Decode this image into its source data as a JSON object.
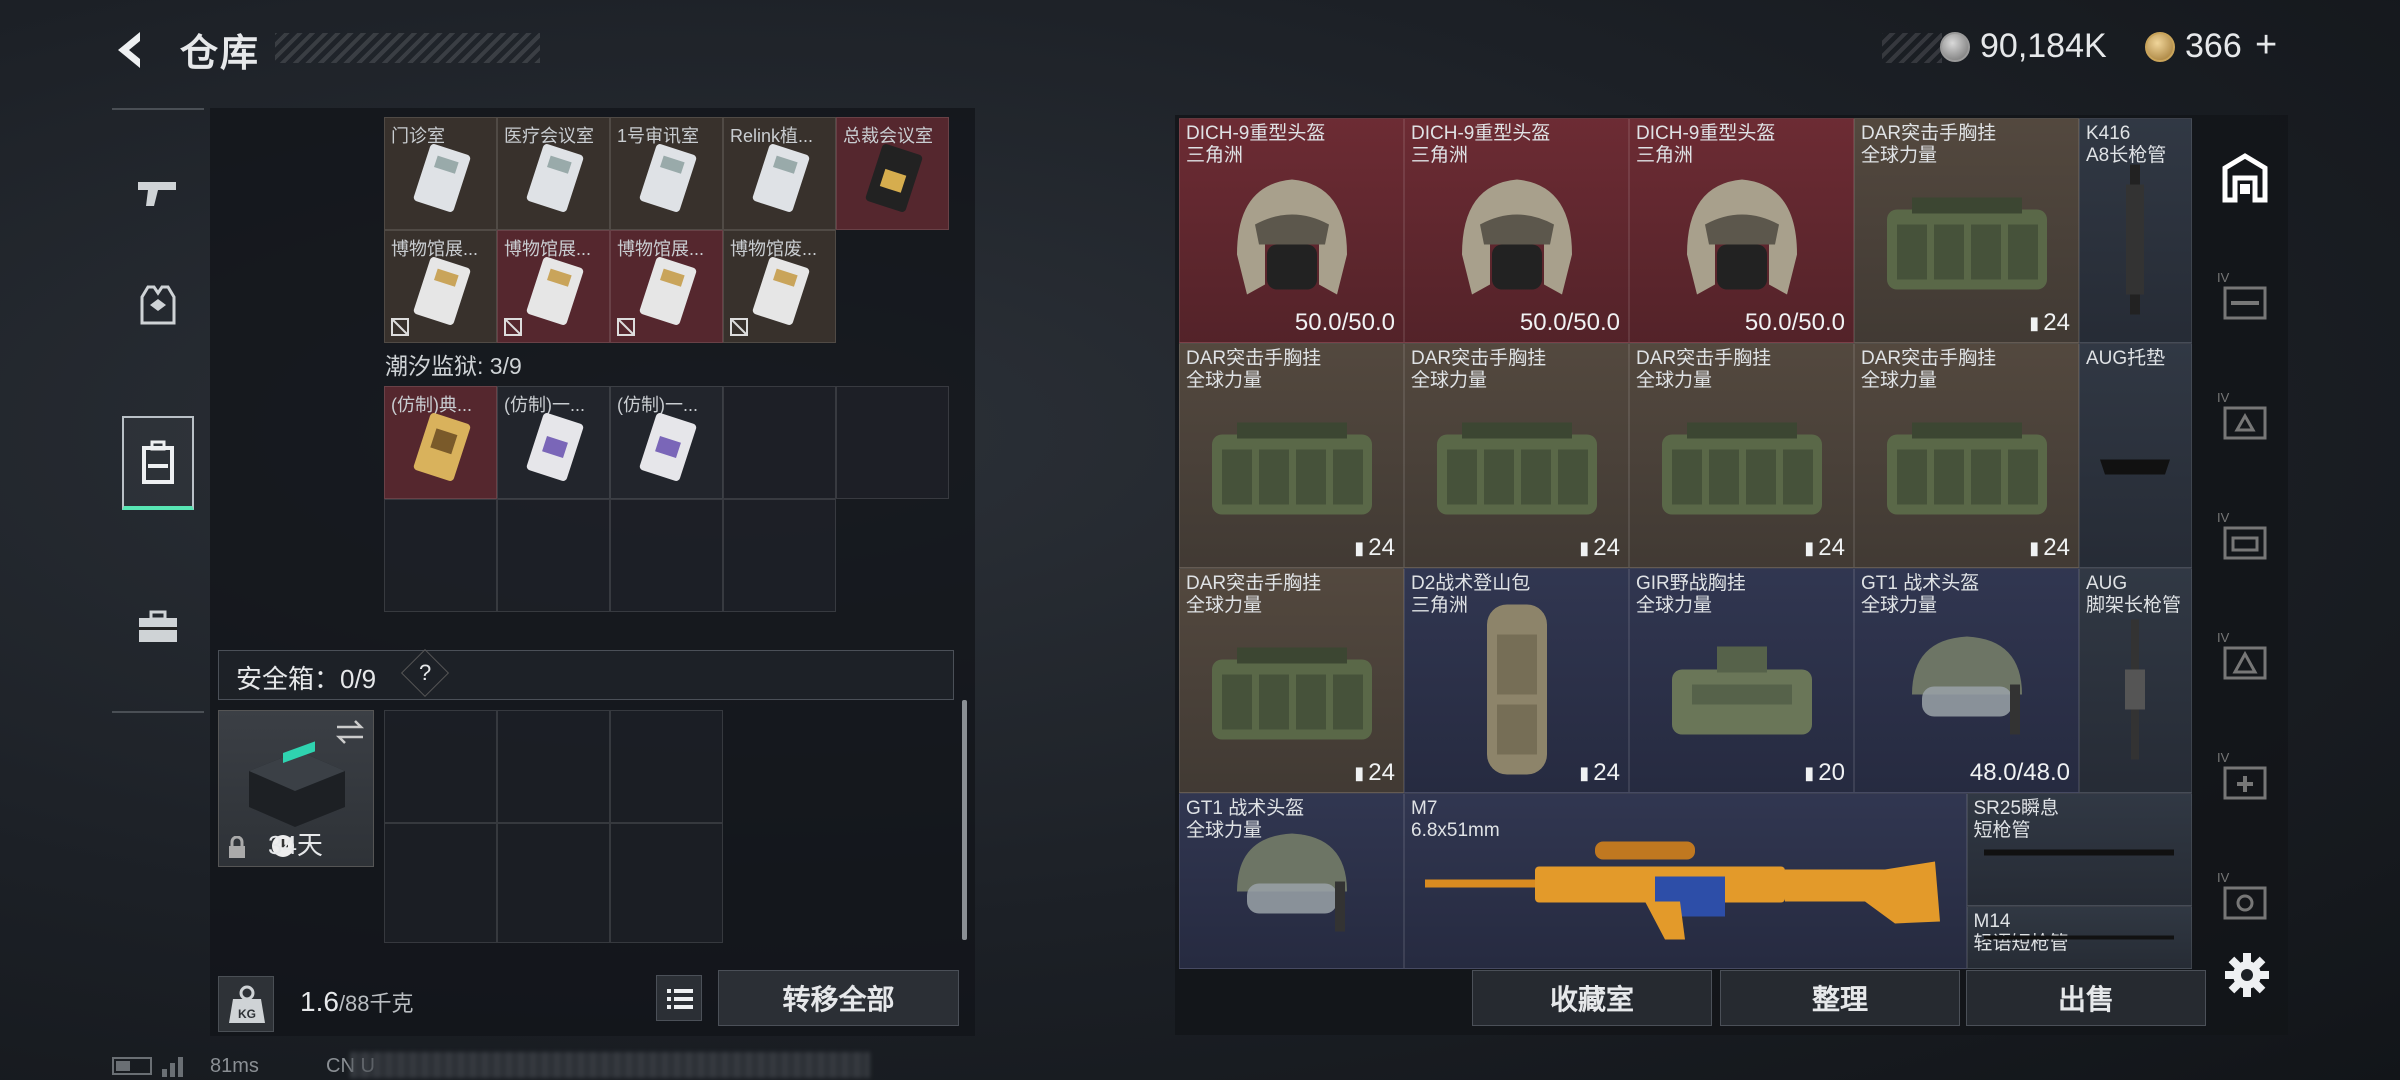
{
  "header": {
    "title": "仓库",
    "money": "90,184K",
    "tickets": "366",
    "plus": "+"
  },
  "nav": [
    {
      "name": "nav-weapons"
    },
    {
      "name": "nav-equipment"
    },
    {
      "name": "nav-storage"
    },
    {
      "name": "nav-toolbox"
    }
  ],
  "keycards": {
    "row1": [
      {
        "label": "门诊室",
        "color": "brown"
      },
      {
        "label": "医疗会议室",
        "color": "brown"
      },
      {
        "label": "1号审讯室",
        "color": "brown"
      },
      {
        "label": "Relink植...",
        "color": "brown"
      },
      {
        "label": "总裁会议室",
        "color": "red"
      }
    ],
    "row2": [
      {
        "label": "博物馆展...",
        "color": "brown"
      },
      {
        "label": "博物馆展...",
        "color": "red"
      },
      {
        "label": "博物馆展...",
        "color": "red"
      },
      {
        "label": "博物馆废...",
        "color": "brown"
      }
    ],
    "prison_label": "潮汐监狱: 3/9",
    "row3": [
      {
        "label": "(仿制)典...",
        "color": "red"
      },
      {
        "label": "(仿制)一...",
        "color": "dark"
      },
      {
        "label": "(仿制)一...",
        "color": "dark"
      }
    ]
  },
  "safe": {
    "label": "安全箱：0/9",
    "help": "?",
    "days": "34天"
  },
  "weight": {
    "current": "1.6",
    "max": "/88千克"
  },
  "transfer_all": "转移全部",
  "items": [
    {
      "name": "DICH-9重型头盔",
      "sub": "三角洲",
      "val": "50.0/50.0",
      "color": "red",
      "icon": "helmet-heavy"
    },
    {
      "name": "DICH-9重型头盔",
      "sub": "三角洲",
      "val": "50.0/50.0",
      "color": "red",
      "icon": "helmet-heavy"
    },
    {
      "name": "DICH-9重型头盔",
      "sub": "三角洲",
      "val": "50.0/50.0",
      "color": "red",
      "icon": "helmet-heavy"
    },
    {
      "name": "DAR突击手胸挂",
      "sub": "全球力量",
      "val": "24",
      "color": "brown",
      "icon": "vest"
    },
    {
      "name": "K416",
      "sub": "A8长枪管",
      "val": "",
      "color": "slate",
      "icon": "barrel"
    },
    {
      "name": "DAR突击手胸挂",
      "sub": "全球力量",
      "val": "24",
      "color": "brown",
      "icon": "vest"
    },
    {
      "name": "DAR突击手胸挂",
      "sub": "全球力量",
      "val": "24",
      "color": "brown",
      "icon": "vest"
    },
    {
      "name": "DAR突击手胸挂",
      "sub": "全球力量",
      "val": "24",
      "color": "brown",
      "icon": "vest"
    },
    {
      "name": "DAR突击手胸挂",
      "sub": "全球力量",
      "val": "24",
      "color": "brown",
      "icon": "vest"
    },
    {
      "name": "AUG托垫",
      "sub": "",
      "val": "",
      "color": "slate",
      "icon": "stockpad"
    },
    {
      "name": "DAR突击手胸挂",
      "sub": "全球力量",
      "val": "24",
      "color": "brown",
      "icon": "vest"
    },
    {
      "name": "D2战术登山包",
      "sub": "三角洲",
      "val": "24",
      "color": "blue",
      "icon": "backpack"
    },
    {
      "name": "GIR野战胸挂",
      "sub": "全球力量",
      "val": "20",
      "color": "blue",
      "icon": "vest-small"
    },
    {
      "name": "GT1 战术头盔",
      "sub": "全球力量",
      "val": "48.0/48.0",
      "color": "blue",
      "icon": "helmet-tac"
    },
    {
      "name": "AUG",
      "sub": "脚架长枪管",
      "val": "",
      "color": "slate",
      "icon": "barrel2"
    },
    {
      "name": "GT1 战术头盔",
      "sub": "全球力量",
      "val": "",
      "color": "blue",
      "icon": "helmet-tac"
    },
    {
      "name": "M7",
      "sub": "6.8x51mm",
      "val": "",
      "color": "blue",
      "icon": "rifle"
    },
    {
      "name": "SR25瞬息",
      "sub": "短枪管",
      "val": "",
      "color": "slate",
      "icon": "barrel3"
    },
    {
      "name": "M14",
      "sub": "轻语短枪管",
      "val": "",
      "color": "slate",
      "icon": "barrel4"
    }
  ],
  "buttons": {
    "collection": "收藏室",
    "sort": "整理",
    "sell": "出售"
  },
  "status": {
    "ping": "81ms",
    "region": "CN U"
  }
}
